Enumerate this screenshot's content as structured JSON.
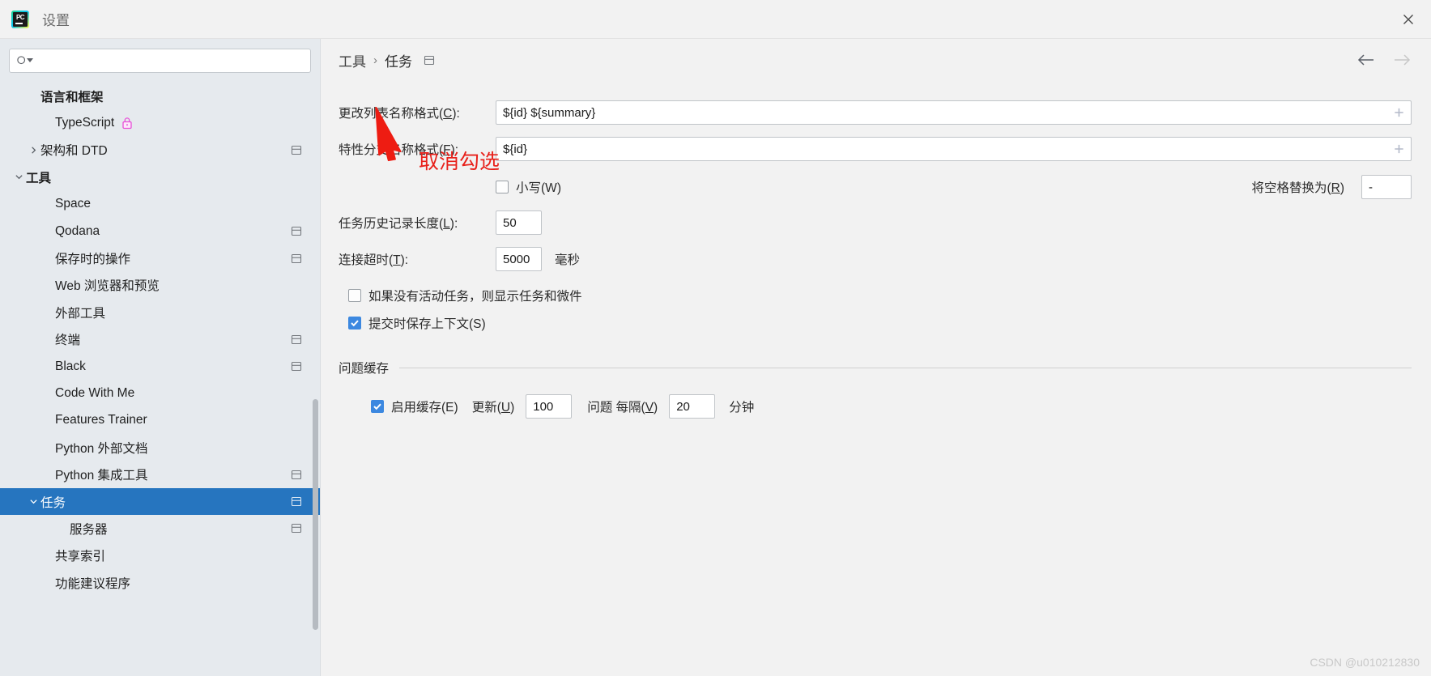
{
  "window": {
    "title": "设置",
    "app_icon": "pycharm-icon",
    "close_label": "×"
  },
  "sidebar": {
    "search": {
      "value": "",
      "placeholder": ""
    },
    "items": [
      {
        "label": "语言和框架",
        "indent": 1,
        "group": true,
        "twisty": "",
        "selected": false,
        "trailing": "",
        "lock": false
      },
      {
        "label": "TypeScript",
        "indent": 2,
        "group": false,
        "twisty": "",
        "selected": false,
        "trailing": "",
        "lock": true
      },
      {
        "label": "架构和 DTD",
        "indent": 1,
        "group": false,
        "twisty": "›",
        "selected": false,
        "trailing": "scope-icon",
        "lock": false
      },
      {
        "label": "工具",
        "indent": 0,
        "group": true,
        "twisty": "⌄",
        "selected": false,
        "trailing": "",
        "lock": false
      },
      {
        "label": "Space",
        "indent": 2,
        "group": false,
        "twisty": "",
        "selected": false,
        "trailing": "",
        "lock": false
      },
      {
        "label": "Qodana",
        "indent": 2,
        "group": false,
        "twisty": "",
        "selected": false,
        "trailing": "scope-icon",
        "lock": false
      },
      {
        "label": "保存时的操作",
        "indent": 2,
        "group": false,
        "twisty": "",
        "selected": false,
        "trailing": "scope-icon",
        "lock": false
      },
      {
        "label": "Web 浏览器和预览",
        "indent": 2,
        "group": false,
        "twisty": "",
        "selected": false,
        "trailing": "",
        "lock": false
      },
      {
        "label": "外部工具",
        "indent": 2,
        "group": false,
        "twisty": "",
        "selected": false,
        "trailing": "",
        "lock": false
      },
      {
        "label": "终端",
        "indent": 2,
        "group": false,
        "twisty": "",
        "selected": false,
        "trailing": "scope-icon",
        "lock": false
      },
      {
        "label": "Black",
        "indent": 2,
        "group": false,
        "twisty": "",
        "selected": false,
        "trailing": "scope-icon",
        "lock": false
      },
      {
        "label": "Code With Me",
        "indent": 2,
        "group": false,
        "twisty": "",
        "selected": false,
        "trailing": "",
        "lock": false
      },
      {
        "label": "Features Trainer",
        "indent": 2,
        "group": false,
        "twisty": "",
        "selected": false,
        "trailing": "",
        "lock": false
      },
      {
        "label": "Python 外部文档",
        "indent": 2,
        "group": false,
        "twisty": "",
        "selected": false,
        "trailing": "",
        "lock": false
      },
      {
        "label": "Python 集成工具",
        "indent": 2,
        "group": false,
        "twisty": "",
        "selected": false,
        "trailing": "scope-icon",
        "lock": false
      },
      {
        "label": "任务",
        "indent": 1,
        "group": false,
        "twisty": "⌄",
        "selected": true,
        "trailing": "scope-icon",
        "lock": false
      },
      {
        "label": "服务器",
        "indent": 3,
        "group": false,
        "twisty": "",
        "selected": false,
        "trailing": "scope-icon",
        "lock": false
      },
      {
        "label": "共享索引",
        "indent": 2,
        "group": false,
        "twisty": "",
        "selected": false,
        "trailing": "",
        "lock": false
      },
      {
        "label": "功能建议程序",
        "indent": 2,
        "group": false,
        "twisty": "",
        "selected": false,
        "trailing": "",
        "lock": false
      }
    ]
  },
  "breadcrumb": {
    "parent": "工具",
    "separator": "›",
    "current": "任务",
    "scope_icon": "scope-icon",
    "back_icon": "arrow-left-icon",
    "forward_icon": "arrow-right-icon"
  },
  "form": {
    "change_list_name_format": {
      "label_text": "更改列表名称格式(",
      "label_mnemonic": "C",
      "label_suffix": "):",
      "value": "${id} ${summary}",
      "add_icon": "plus-icon"
    },
    "feature_branch_name_format": {
      "label_text": "特性分支名称格式(",
      "label_mnemonic": "F",
      "label_suffix": "):",
      "value": "${id}",
      "add_icon": "plus-icon"
    },
    "lowercase": {
      "label_text": "小写(",
      "label_mnemonic": "W",
      "label_suffix": ")",
      "checked": false
    },
    "replace_spaces_with": {
      "label_text": "将空格替换为(",
      "label_mnemonic": "R",
      "label_suffix": ")",
      "value": "-"
    },
    "task_history_length": {
      "label_text": "任务历史记录长度(",
      "label_mnemonic": "L",
      "label_suffix": "):",
      "value": "50"
    },
    "connection_timeout": {
      "label_text": "连接超时(",
      "label_mnemonic": "T",
      "label_suffix": "):",
      "value": "5000",
      "unit": "毫秒"
    },
    "show_tasks_widget": {
      "label_text": "如果没有活动任务，则显示任务和微件",
      "checked": false
    },
    "save_context_on_commit": {
      "label_text": "提交时保存上下文(",
      "label_mnemonic": "S",
      "label_suffix": ")",
      "checked": true
    },
    "issue_cache_section": {
      "title": "问题缓存"
    },
    "enable_cache": {
      "label_text": "启用缓存(",
      "label_mnemonic": "E",
      "label_suffix": ")",
      "checked": true
    },
    "update_count": {
      "label_text": "更新(",
      "label_mnemonic": "U",
      "label_suffix": ")",
      "value": "100"
    },
    "issues_every": {
      "label_text": "问题 每隔(",
      "label_mnemonic": "V",
      "label_suffix": ")",
      "value": "20",
      "unit": "分钟"
    }
  },
  "annotation": {
    "text": "取消勾选",
    "color": "#e8201a",
    "arrow_icon": "red-arrow-icon"
  },
  "watermark": {
    "text": "CSDN @u010212830"
  },
  "colors": {
    "selection": "#2675bf",
    "checkbox_checked": "#3c88e0",
    "sidebar_bg": "#e6eaee",
    "panel_bg": "#f2f2f2",
    "annotation_red": "#e8201a"
  }
}
